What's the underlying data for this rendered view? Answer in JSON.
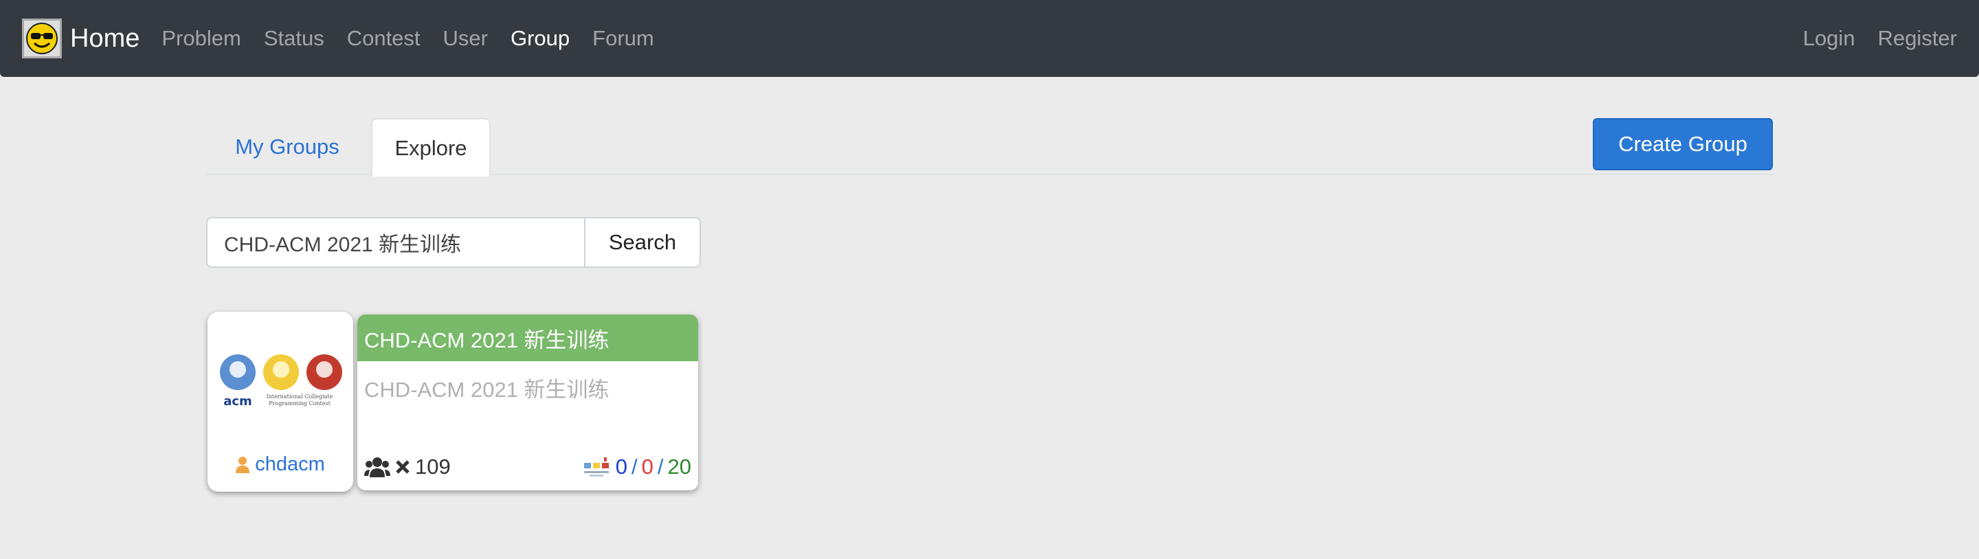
{
  "navbar": {
    "brand": "Home",
    "links": [
      "Problem",
      "Status",
      "Contest",
      "User",
      "Group",
      "Forum"
    ],
    "active": "Group",
    "right_links": [
      "Login",
      "Register"
    ]
  },
  "tabs": {
    "my_groups": "My Groups",
    "explore": "Explore",
    "active": "Explore"
  },
  "create_group_label": "Create Group",
  "search": {
    "value": "CHD-ACM 2021 新生训练",
    "button": "Search"
  },
  "owner": {
    "name": "chdacm",
    "logo_caption_line1": "International Collegiate",
    "logo_caption_line2": "Programming Contest"
  },
  "group": {
    "title": "CHD-ACM 2021 新生训练",
    "description": "CHD-ACM 2021 新生训练",
    "members": "109",
    "stat_blue": "0",
    "stat_red": "0",
    "stat_green": "20",
    "header_color": "#78b96a"
  },
  "colors": {
    "navbar": "#343a40",
    "accent": "#2a78d6",
    "link": "#2a72d4"
  }
}
